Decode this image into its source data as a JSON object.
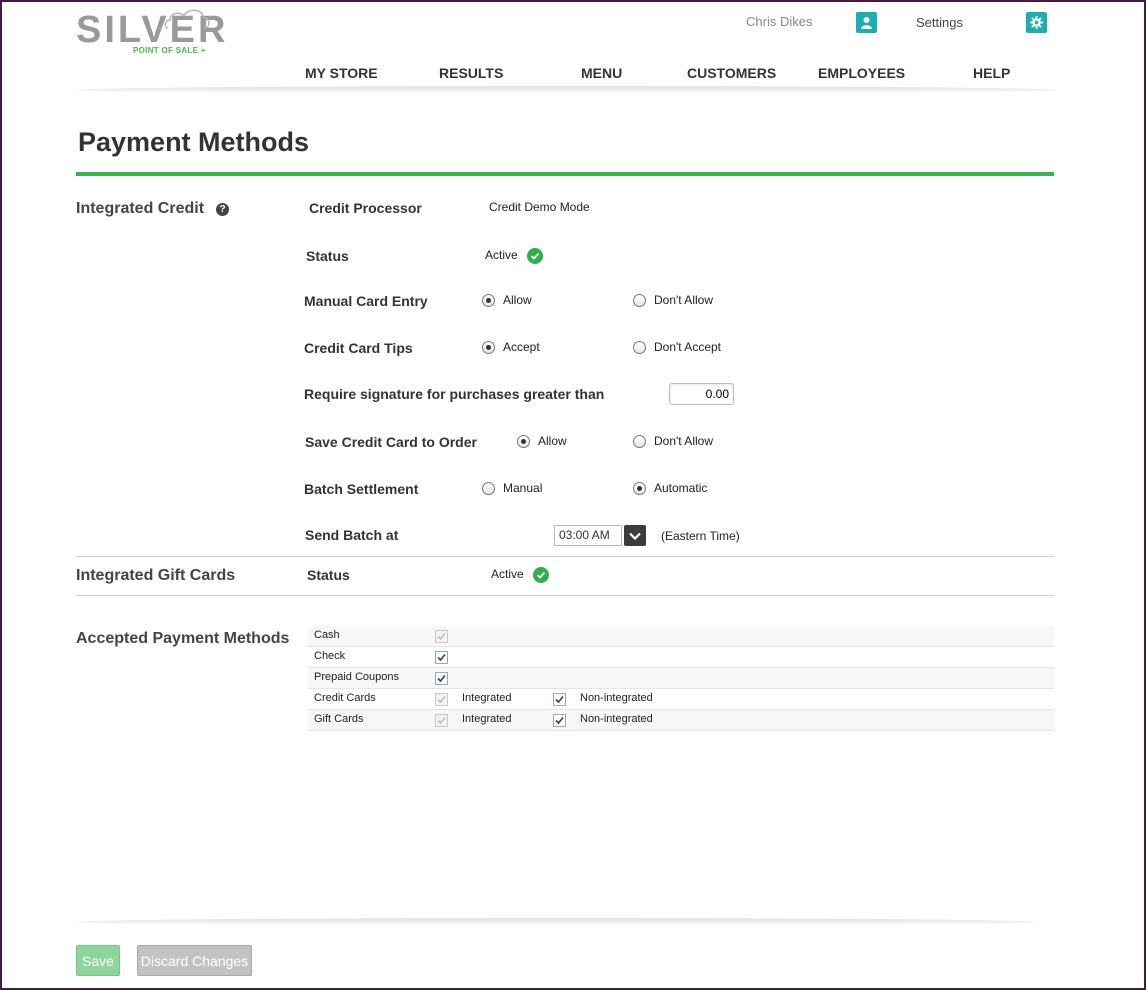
{
  "header": {
    "logo_text": "SILVER",
    "logo_tagline": "POINT OF SALE +",
    "user_name": "Chris Dikes",
    "settings_label": "Settings"
  },
  "nav": {
    "items": [
      "MY STORE",
      "RESULTS",
      "MENU",
      "CUSTOMERS",
      "EMPLOYEES",
      "HELP"
    ]
  },
  "page": {
    "title": "Payment Methods"
  },
  "integrated_credit": {
    "section_label": "Integrated Credit",
    "help_glyph": "?",
    "credit_processor_label": "Credit Processor",
    "credit_processor_value": "Credit Demo Mode",
    "status_label": "Status",
    "status_value": "Active",
    "manual_card_entry": {
      "label": "Manual Card Entry",
      "options": [
        "Allow",
        "Don't Allow"
      ],
      "selected": "Allow"
    },
    "credit_card_tips": {
      "label": "Credit Card Tips",
      "options": [
        "Accept",
        "Don't Accept"
      ],
      "selected": "Accept"
    },
    "signature": {
      "label": "Require signature for purchases greater than",
      "value": "0.00"
    },
    "save_card": {
      "label": "Save Credit Card to Order",
      "options": [
        "Allow",
        "Don't Allow"
      ],
      "selected": "Allow"
    },
    "batch_settlement": {
      "label": "Batch Settlement",
      "options": [
        "Manual",
        "Automatic"
      ],
      "selected": "Automatic"
    },
    "send_batch": {
      "label": "Send Batch at",
      "value": "03:00 AM",
      "timezone": "(Eastern Time)"
    }
  },
  "gift_cards": {
    "section_label": "Integrated Gift Cards",
    "status_label": "Status",
    "status_value": "Active"
  },
  "accepted": {
    "section_label": "Accepted Payment Methods",
    "rows": [
      {
        "label": "Cash",
        "checked": true,
        "disabled": true
      },
      {
        "label": "Check",
        "checked": true,
        "disabled": false
      },
      {
        "label": "Prepaid Coupons",
        "checked": true,
        "disabled": false
      },
      {
        "label": "Credit Cards",
        "checked": true,
        "disabled": true,
        "integrated_label": "Integrated",
        "non_integrated_label": "Non-integrated",
        "non_integrated_checked": true
      },
      {
        "label": "Gift Cards",
        "checked": true,
        "disabled": true,
        "integrated_label": "Integrated",
        "non_integrated_label": "Non-integrated",
        "non_integrated_checked": true
      }
    ]
  },
  "footer": {
    "save_label": "Save",
    "discard_label": "Discard Changes"
  },
  "colors": {
    "accent_green": "#3bb44a",
    "teal": "#1ab0b0",
    "frame": "#4a1942"
  }
}
